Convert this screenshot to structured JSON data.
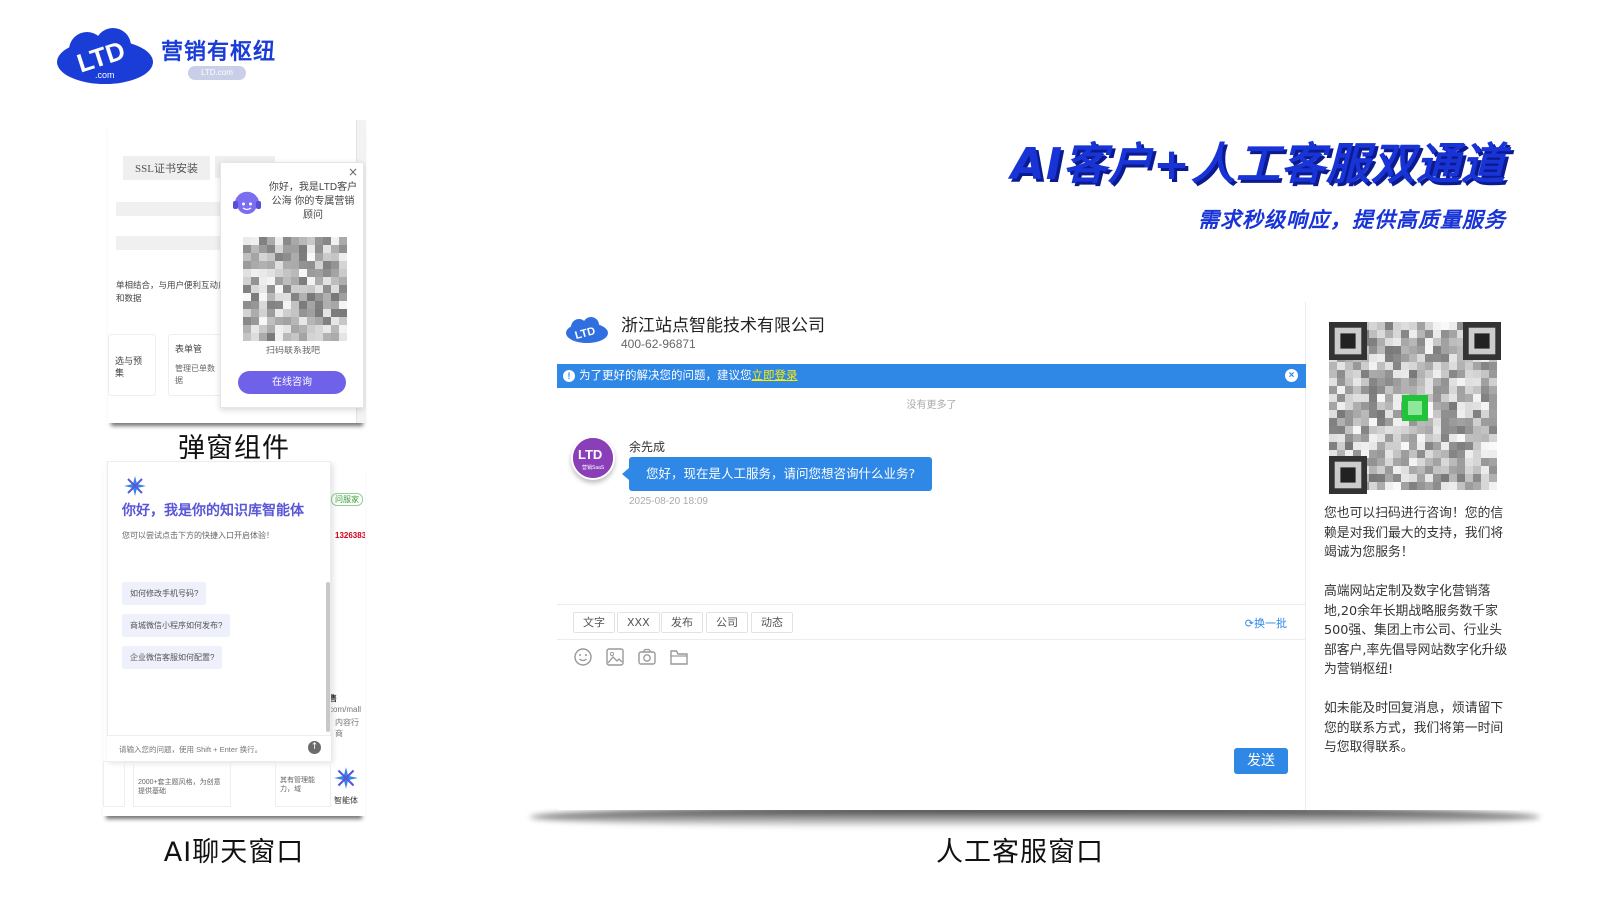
{
  "brand": {
    "logo_text": "LTD",
    "logo_sub": ".com",
    "name": "营销有枢纽",
    "pill": "LTD.com"
  },
  "headline": {
    "main": "AI客户+人工客服双通道",
    "sub": "需求秒级响应，提供高质量服务"
  },
  "popup_demo": {
    "caption": "弹窗组件",
    "bg_tab": "SSL证书安装",
    "bg_text": "单相结合，与用户便利互动反馈和数据",
    "bg_card_left": "选与预集",
    "bg_card_right_title": "表单管",
    "bg_card_right_text": "管理已单数据",
    "widget": {
      "greeting": "你好，我是LTD客户公海 你的专属营销顾问",
      "qr_caption": "扫码联系我吧",
      "online_button": "在线咨询",
      "close": "×"
    }
  },
  "ai_demo": {
    "caption": "AI聊天窗口",
    "title": "你好，我是你的知识库智能体",
    "hint": "您可以尝试点击下方的快捷入口开启体验！",
    "questions": [
      "如何修改手机号码?",
      "商城微信小程序如何发布?",
      "企业微信客服如何配置?"
    ],
    "input_placeholder": "请输入您的问题，使用 Shift + Enter 换行。",
    "send_glyph": "↑",
    "float_label": "智能体",
    "bg_badge": "问服家",
    "bg_phone": "1326383",
    "bg_sell": "售",
    "bg_card_a": "2000+套主题风格，为创意提供基础",
    "bg_card_b": "其有管理能力，域",
    "bg_mall": "com/mall",
    "bg_content": "内容行商"
  },
  "cs_demo": {
    "caption": "人工客服窗口",
    "company": "浙江站点智能技术有限公司",
    "phone": "400-62-96871",
    "banner_text": "为了更好的解决您的问题，建议您",
    "banner_link": "立即登录",
    "banner_close": "×",
    "no_more": "没有更多了",
    "agent_name": "余先成",
    "avatar_text": "LTD",
    "avatar_sub": "营销SaaS",
    "message": "您好，现在是人工服务，请问您想咨询什么业务?",
    "time": "2025-08-20 18:09",
    "chips": [
      "文字",
      "XXX",
      "发布",
      "公司",
      "动态"
    ],
    "refresh": "换一批",
    "send": "发送",
    "side_paragraphs": [
      "您也可以扫码进行咨询！您的信赖是对我们最大的支持，我们将竭诚为您服务！",
      "高端网站定制及数字化营销落地,20余年长期战略服务数千家500强、集团上市公司、行业头部客户,率先倡导网站数字化升级为营销枢纽!",
      "如未能及时回复消息，烦请留下您的联系方式，我们将第一时间与您取得联系。"
    ]
  },
  "colors": {
    "brand_blue": "#1a3dd8",
    "headline_blue": "#1834d6",
    "chat_blue": "#2f87e6",
    "purple": "#6f61e8",
    "avatar_purple": "#8a3fb8"
  },
  "icons": [
    "ltd-cloud-logo",
    "close-icon",
    "headset-icon",
    "qr-code",
    "star-icon",
    "send-arrow-icon",
    "info-icon",
    "refresh-icon",
    "emoji-icon",
    "image-icon",
    "camera-icon",
    "folder-icon"
  ]
}
